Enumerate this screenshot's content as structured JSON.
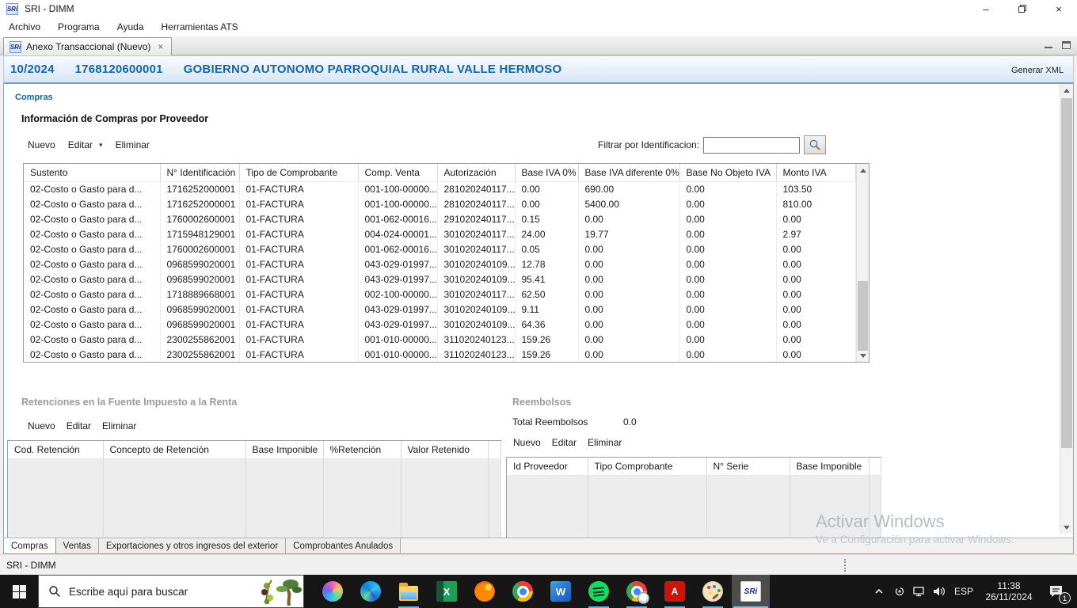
{
  "titlebar": {
    "title": "SRI - DIMM"
  },
  "menubar": {
    "items": [
      {
        "label": "Archivo"
      },
      {
        "label": "Programa"
      },
      {
        "label": "Ayuda"
      },
      {
        "label": "Herramientas ATS"
      }
    ]
  },
  "tabstrip": {
    "active_tab": "Anexo Transaccional (Nuevo)"
  },
  "glyphs": {
    "sri_logo": "SRi",
    "caret_down": "▾",
    "close_tab": "×",
    "win_minimize": "–",
    "win_close": "×"
  },
  "header": {
    "period": "10/2024",
    "ruc": "1768120600001",
    "entity": "GOBIERNO AUTONOMO PARROQUIAL RURAL VALLE HERMOSO",
    "generar_xml": "Generar XML"
  },
  "compras": {
    "section_label": "Compras",
    "title": "Información de Compras por Proveedor",
    "toolbar": {
      "nuevo": "Nuevo",
      "editar": "Editar",
      "eliminar": "Eliminar"
    },
    "filter_label": "Filtrar por Identificacion:",
    "filter_value": "",
    "table": {
      "headers": [
        {
          "label": "Sustento"
        },
        {
          "label": "N° Identificación"
        },
        {
          "label": "Tipo de Comprobante"
        },
        {
          "label": "Comp. Venta"
        },
        {
          "label": "Autorización"
        },
        {
          "label": "Base IVA 0%"
        },
        {
          "label": "Base IVA diferente 0%"
        },
        {
          "label": "Base No Objeto IVA"
        },
        {
          "label": "Monto IVA"
        }
      ],
      "rows": [
        [
          "02-Costo o Gasto para d...",
          "1716252000001",
          "01-FACTURA",
          "001-100-00000...",
          "281020240117...",
          "0.00",
          "690.00",
          "0.00",
          "103.50"
        ],
        [
          "02-Costo o Gasto para d...",
          "1716252000001",
          "01-FACTURA",
          "001-100-00000...",
          "281020240117...",
          "0.00",
          "5400.00",
          "0.00",
          "810.00"
        ],
        [
          "02-Costo o Gasto para d...",
          "1760002600001",
          "01-FACTURA",
          "001-062-00016...",
          "291020240117...",
          "0.15",
          "0.00",
          "0.00",
          "0.00"
        ],
        [
          "02-Costo o Gasto para d...",
          "1715948129001",
          "01-FACTURA",
          "004-024-00001...",
          "301020240117...",
          "24.00",
          "19.77",
          "0.00",
          "2.97"
        ],
        [
          "02-Costo o Gasto para d...",
          "1760002600001",
          "01-FACTURA",
          "001-062-00016...",
          "301020240117...",
          "0.05",
          "0.00",
          "0.00",
          "0.00"
        ],
        [
          "02-Costo o Gasto para d...",
          "0968599020001",
          "01-FACTURA",
          "043-029-01997...",
          "301020240109...",
          "12.78",
          "0.00",
          "0.00",
          "0.00"
        ],
        [
          "02-Costo o Gasto para d...",
          "0968599020001",
          "01-FACTURA",
          "043-029-01997...",
          "301020240109...",
          "95.41",
          "0.00",
          "0.00",
          "0.00"
        ],
        [
          "02-Costo o Gasto para d...",
          "1718889668001",
          "01-FACTURA",
          "002-100-00000...",
          "301020240117...",
          "62.50",
          "0.00",
          "0.00",
          "0.00"
        ],
        [
          "02-Costo o Gasto para d...",
          "0968599020001",
          "01-FACTURA",
          "043-029-01997...",
          "301020240109...",
          "9.11",
          "0.00",
          "0.00",
          "0.00"
        ],
        [
          "02-Costo o Gasto para d...",
          "0968599020001",
          "01-FACTURA",
          "043-029-01997...",
          "301020240109...",
          "64.36",
          "0.00",
          "0.00",
          "0.00"
        ],
        [
          "02-Costo o Gasto para d...",
          "2300255862001",
          "01-FACTURA",
          "001-010-00000...",
          "311020240123...",
          "159.26",
          "0.00",
          "0.00",
          "0.00"
        ],
        [
          "02-Costo o Gasto para d...",
          "2300255862001",
          "01-FACTURA",
          "001-010-00000...",
          "311020240123...",
          "159.26",
          "0.00",
          "0.00",
          "0.00"
        ]
      ]
    }
  },
  "retenciones": {
    "title": "Retenciones en la Fuente  Impuesto a la Renta",
    "toolbar": {
      "nuevo": "Nuevo",
      "editar": "Editar",
      "eliminar": "Eliminar"
    },
    "headers": [
      {
        "label": "Cod. Retención"
      },
      {
        "label": "Concepto de Retención"
      },
      {
        "label": "Base Imponible"
      },
      {
        "label": "%Retención"
      },
      {
        "label": "Valor Retenido"
      },
      {
        "label": ""
      }
    ]
  },
  "reembolsos": {
    "title": "Reembolsos",
    "total_label": "Total Reembolsos",
    "total_value": "0.0",
    "toolbar": {
      "nuevo": "Nuevo",
      "editar": "Editar",
      "eliminar": "Eliminar"
    },
    "headers": [
      {
        "label": "Id Proveedor"
      },
      {
        "label": "Tipo Comprobante"
      },
      {
        "label": "N° Serie"
      },
      {
        "label": "Base Imponible"
      },
      {
        "label": ""
      }
    ]
  },
  "bottom_tabs": {
    "items": [
      {
        "label": "Compras",
        "state": "active"
      },
      {
        "label": "Ventas",
        "state": "inactive"
      },
      {
        "label": "Exportaciones y otros ingresos del exterior",
        "state": "inactive"
      },
      {
        "label": "Comprobantes Anulados",
        "state": "inactive"
      }
    ]
  },
  "statusbar": {
    "text": "SRI - DIMM"
  },
  "watermark": {
    "line1": "Activar Windows",
    "line2": "Ve a Configuración para activar Windows."
  },
  "taskbar": {
    "search_placeholder": "Escribe aquí para buscar",
    "icons": [
      {
        "name": "copilot",
        "glyph": "",
        "state": "idle"
      },
      {
        "name": "edge",
        "glyph": "",
        "state": "idle"
      },
      {
        "name": "explorer",
        "glyph": "",
        "state": "running"
      },
      {
        "name": "excel",
        "glyph": "X",
        "state": "idle"
      },
      {
        "name": "firefox",
        "glyph": "",
        "state": "idle"
      },
      {
        "name": "chrome",
        "glyph": "",
        "state": "idle"
      },
      {
        "name": "word",
        "glyph": "W",
        "state": "idle"
      },
      {
        "name": "spotify",
        "glyph": "",
        "state": "running"
      },
      {
        "name": "chrome-profile",
        "glyph": "",
        "state": "running"
      },
      {
        "name": "acrobat",
        "glyph": "A",
        "state": "running"
      },
      {
        "name": "paint",
        "glyph": "",
        "state": "running"
      },
      {
        "name": "sri",
        "glyph": "SRi",
        "state": "active"
      }
    ],
    "tray": {
      "language": "ESP",
      "time": "11:38",
      "date": "26/11/2024",
      "notification_count": "1"
    }
  },
  "colors": {
    "accent_blue": "#1565a8",
    "section_title_gray": "#9b9b9b",
    "taskbar_bg": "#161616",
    "watermark": "#a9b2ba",
    "running_indicator": "#6cb2e2"
  }
}
